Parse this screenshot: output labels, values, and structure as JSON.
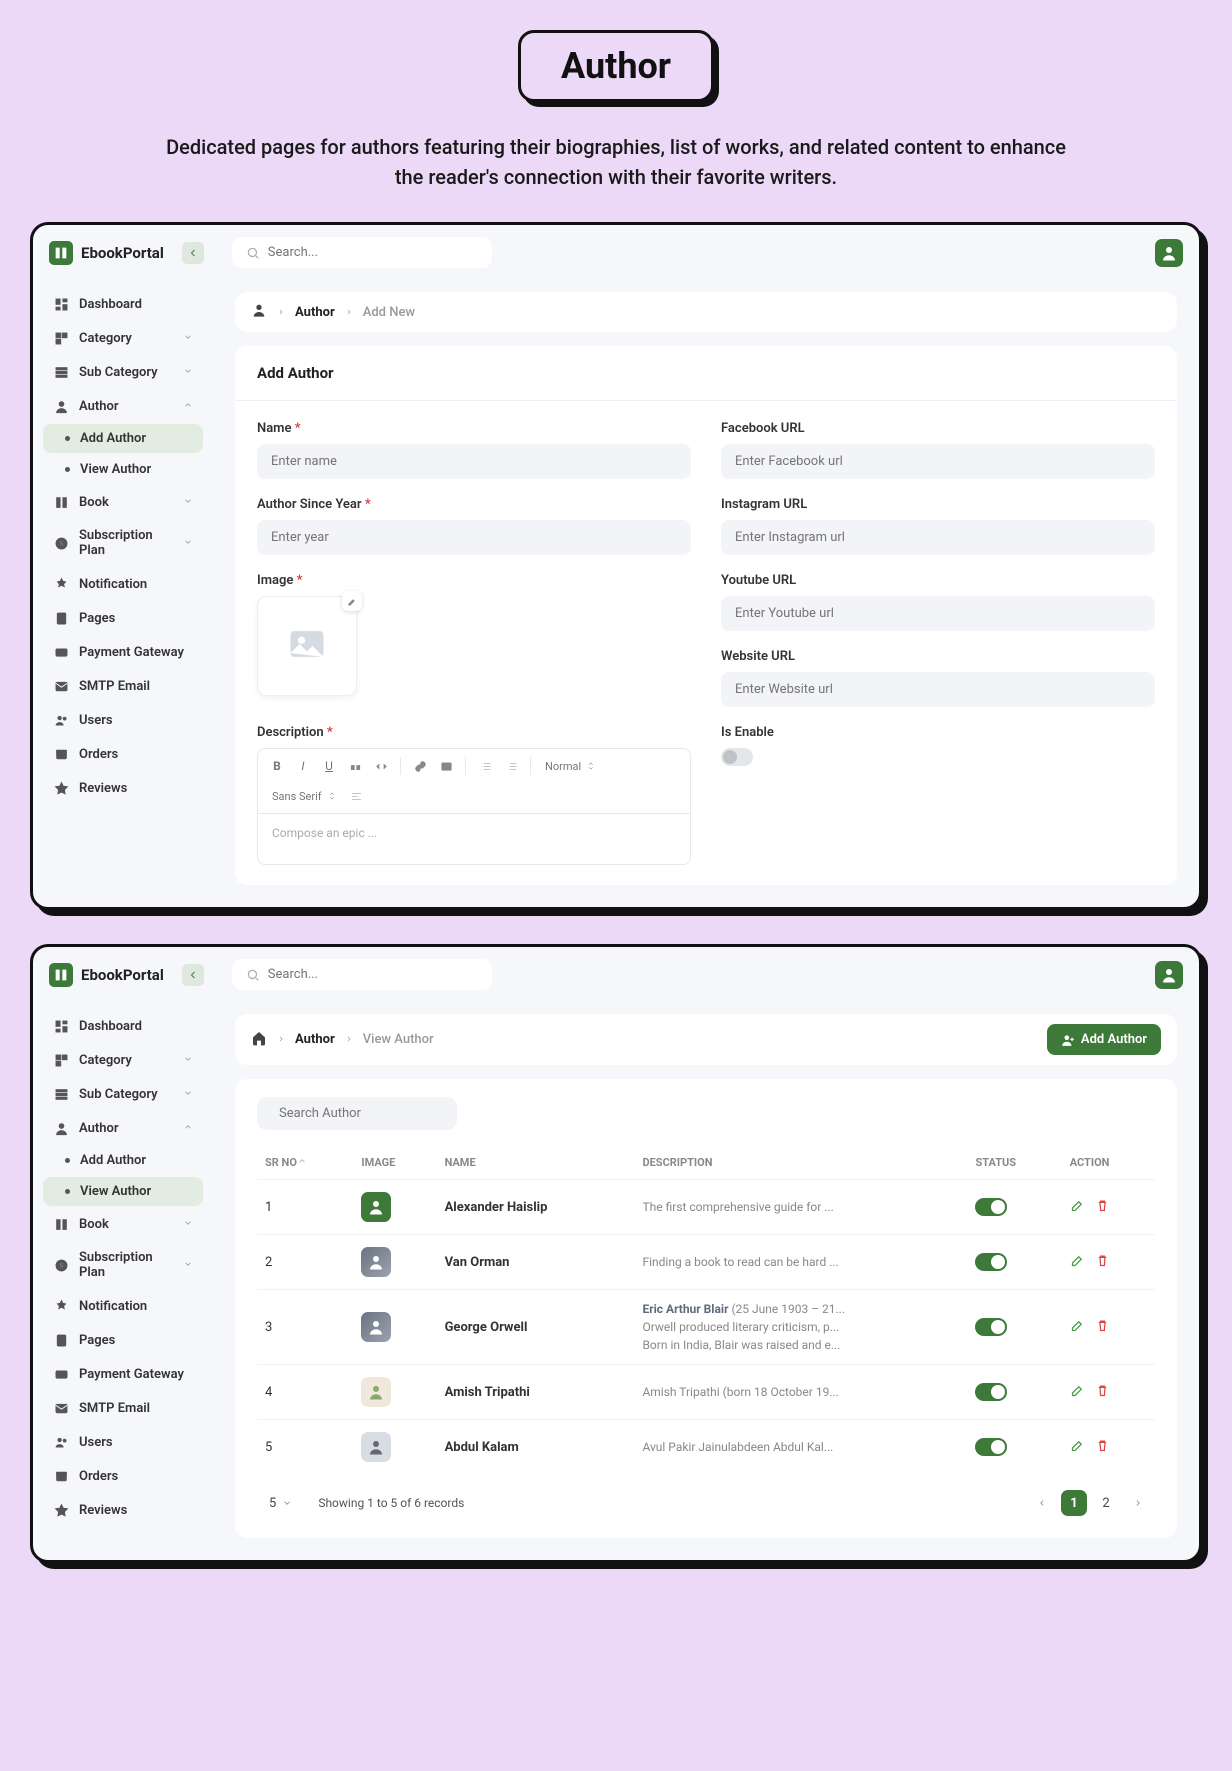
{
  "header": {
    "title": "Author",
    "subtitle": "Dedicated pages for authors featuring their biographies, list of works, and related content to enhance the reader's connection with their favorite writers."
  },
  "app": {
    "name": "EbookPortal",
    "search_placeholder": "Search..."
  },
  "nav": {
    "dashboard": "Dashboard",
    "category": "Category",
    "sub_category": "Sub Category",
    "author": "Author",
    "add_author": "Add Author",
    "view_author": "View Author",
    "book": "Book",
    "subscription_plan": "Subscription Plan",
    "notification": "Notification",
    "pages": "Pages",
    "payment_gateway": "Payment Gateway",
    "smtp_email": "SMTP Email",
    "users": "Users",
    "orders": "Orders",
    "reviews": "Reviews"
  },
  "panel1": {
    "crumb": {
      "parent": "Author",
      "current": "Add New"
    },
    "card_title": "Add Author",
    "fields": {
      "name_label": "Name",
      "name_ph": "Enter name",
      "year_label": "Author Since Year",
      "year_ph": "Enter year",
      "image_label": "Image",
      "desc_label": "Description",
      "fb_label": "Facebook URL",
      "fb_ph": "Enter Facebook url",
      "ig_label": "Instagram URL",
      "ig_ph": "Enter Instagram url",
      "yt_label": "Youtube URL",
      "yt_ph": "Enter Youtube url",
      "web_label": "Website URL",
      "web_ph": "Enter Website url",
      "enable_label": "Is Enable"
    },
    "rte": {
      "font": "Sans Serif",
      "heading": "Normal",
      "placeholder": "Compose an epic ..."
    }
  },
  "panel2": {
    "crumb": {
      "parent": "Author",
      "current": "View Author"
    },
    "add_btn": "Add Author",
    "search_ph": "Search Author",
    "cols": {
      "sr": "SR NO",
      "image": "IMAGE",
      "name": "NAME",
      "desc": "DESCRIPTION",
      "status": "STATUS",
      "action": "ACTION"
    },
    "rows": [
      {
        "sr": "1",
        "name": "Alexander Haislip",
        "desc": "The first comprehensive guide for ..."
      },
      {
        "sr": "2",
        "name": "Van Orman",
        "desc": "Finding a book to read can be hard ..."
      },
      {
        "sr": "3",
        "name": "George Orwell",
        "desc1_b": "Eric Arthur Blair",
        "desc1_r": " (25 June 1903 – 21...",
        "desc2": "Orwell produced literary criticism, p...",
        "desc3": "Born in India, Blair was raised and e..."
      },
      {
        "sr": "4",
        "name": "Amish Tripathi",
        "desc": "Amish Tripathi (born 18 October 19..."
      },
      {
        "sr": "5",
        "name": "Abdul Kalam",
        "desc": "Avul Pakir Jainulabdeen Abdul Kal..."
      }
    ],
    "footer": {
      "page_size": "5",
      "count_text": "Showing 1 to 5 of 6 records",
      "pages": [
        "1",
        "2"
      ]
    }
  }
}
